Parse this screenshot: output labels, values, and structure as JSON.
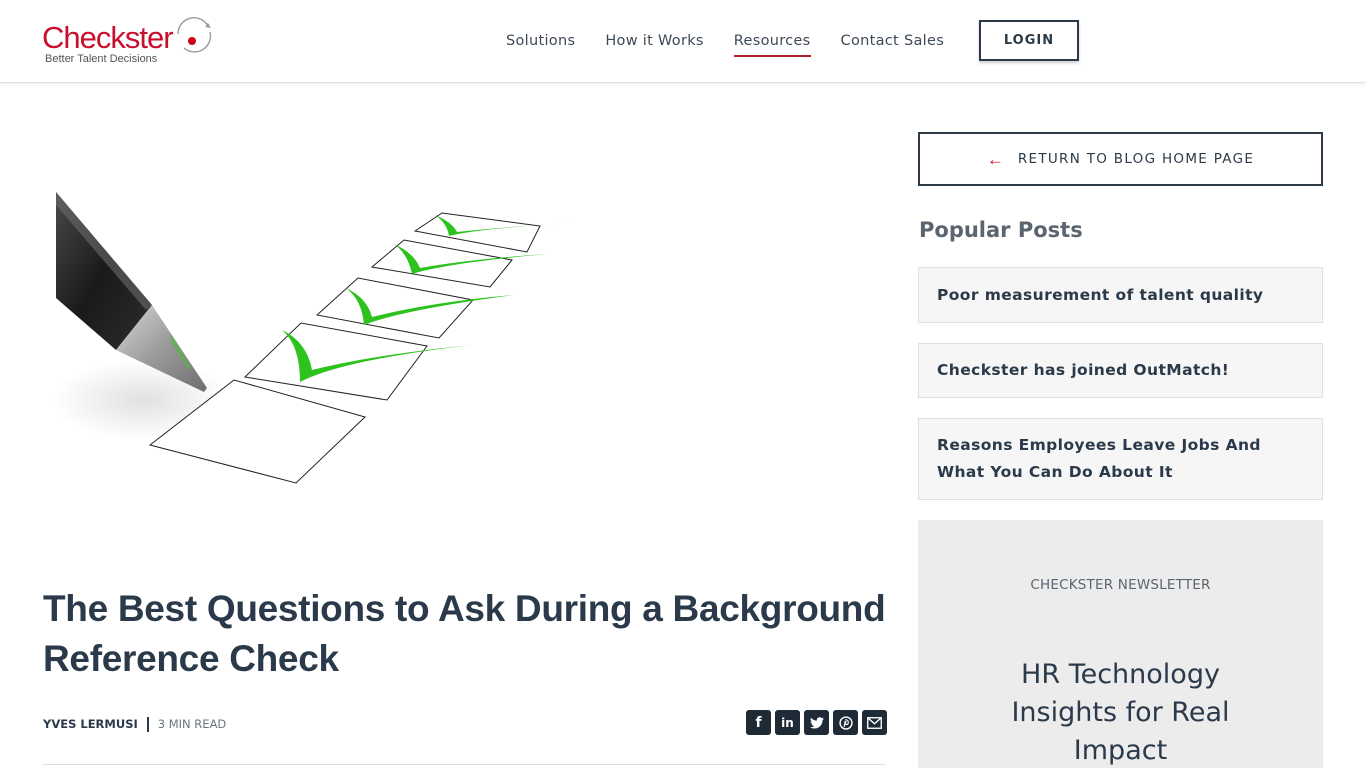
{
  "header": {
    "logo": {
      "brand": "Checkster",
      "tagline": "Better Talent Decisions"
    },
    "nav": [
      {
        "label": "Solutions",
        "active": false
      },
      {
        "label": "How it Works",
        "active": false
      },
      {
        "label": "Resources",
        "active": true
      },
      {
        "label": "Contact Sales",
        "active": false
      }
    ],
    "login_label": "LOGIN"
  },
  "article": {
    "hero_image": "pen-checklist-illustration",
    "title": "The Best Questions to Ask During a Background Reference Check",
    "author": "YVES LERMUSI",
    "read_time": "3 MIN READ",
    "share": [
      {
        "icon": "facebook-icon",
        "glyph": "f"
      },
      {
        "icon": "linkedin-icon",
        "glyph": "in"
      },
      {
        "icon": "twitter-icon",
        "glyph": ""
      },
      {
        "icon": "pinterest-icon",
        "glyph": ""
      },
      {
        "icon": "email-icon",
        "glyph": ""
      }
    ]
  },
  "sidebar": {
    "return_label": "RETURN TO BLOG HOME PAGE",
    "return_icon": "arrow-left-icon",
    "popular_title": "Popular Posts",
    "popular_posts": [
      {
        "title": "Poor measurement of talent quality"
      },
      {
        "title": "Checkster has joined OutMatch!"
      },
      {
        "title": "Reasons Employees Leave Jobs And What You Can Do About It"
      }
    ],
    "newsletter": {
      "kicker": "CHECKSTER NEWSLETTER",
      "title": "HR Technology Insights for Real Impact"
    }
  },
  "colors": {
    "brand_red": "#c8102e",
    "text_dark": "#2b3a4a",
    "accent_green": "#2ec21f",
    "nav_underline": "#b0232a"
  }
}
